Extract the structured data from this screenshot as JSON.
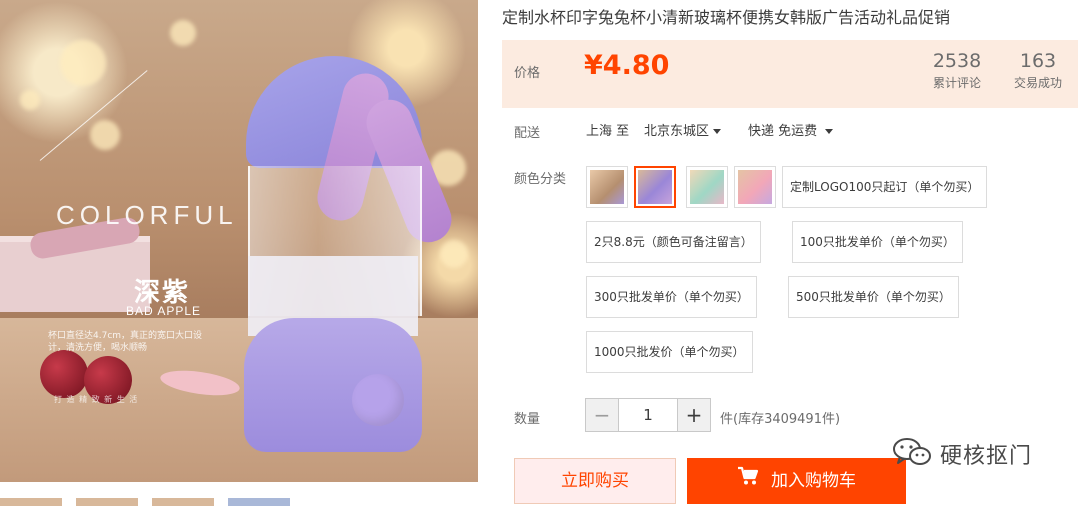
{
  "photo": {
    "colorful_text": "COLORFUL",
    "color_name": "深紫",
    "sub_name": "BAD APPLE",
    "detail_text": "杯口直径达4.7cm，真正的宽口大口设计，清洗方便，喝水顺畅",
    "footer_text": "打 造 精 致 新 生 活"
  },
  "product": {
    "title": "定制水杯印字兔兔杯小清新玻璃杯便携女韩版广告活动礼品促销"
  },
  "price": {
    "label": "价格",
    "value": "¥4.80",
    "reviews_count": "2538",
    "reviews_label": "累计评论",
    "sales_count": "163",
    "sales_label": "交易成功"
  },
  "shipping": {
    "label": "配送",
    "from": "上海 至",
    "to": "北京东城区",
    "method": "快递 免运费"
  },
  "options": {
    "label": "颜色分类",
    "image_swatches": [
      "swatch-1",
      "swatch-2",
      "swatch-3",
      "swatch-4"
    ],
    "text_options": [
      "定制LOGO100只起订（单个勿买）",
      "2只8.8元（颜色可备注留言）",
      "100只批发单价（单个勿买）",
      "300只批发单价（单个勿买）",
      "500只批发单价（单个勿买）",
      "1000只批发价（单个勿买）"
    ]
  },
  "quantity": {
    "label": "数量",
    "minus": "−",
    "value": "1",
    "plus": "+",
    "stock_text": "件(库存3409491件)"
  },
  "actions": {
    "buy_now": "立即购买",
    "add_to_cart": "加入购物车"
  },
  "watermark": {
    "text": "硬核抠门"
  },
  "colors": {
    "accent": "#ff4400",
    "price_bg": "#fcebe0",
    "buy_now_bg": "#ffeded"
  }
}
